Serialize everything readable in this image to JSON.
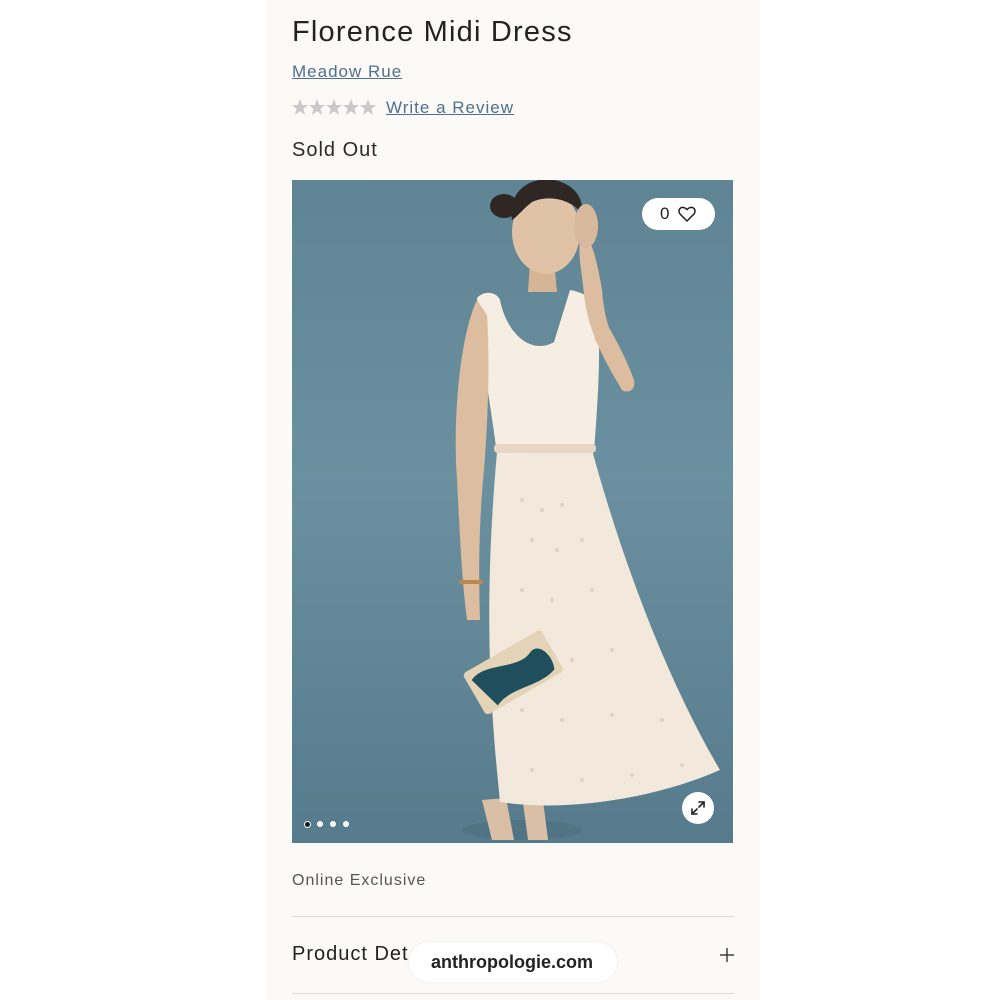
{
  "product": {
    "title": "Florence Midi Dress",
    "brand": "Meadow Rue",
    "rating": {
      "stars_filled": 0,
      "stars_total": 5,
      "review_link": "Write a Review"
    },
    "status": "Sold Out",
    "wishlist_count": "0",
    "tag": "Online Exclusive"
  },
  "gallery": {
    "image_count": 4,
    "active_index": 0,
    "icons": {
      "wishlist": "heart-outline-icon",
      "zoom": "expand-arrows-icon"
    }
  },
  "accordion": {
    "product_details_label": "Product Det",
    "toggle_icon": "plus-icon"
  },
  "watermark": "anthropologie.com",
  "colors": {
    "link": "#4f6f8e",
    "background": "#fbfaf6",
    "photo_backdrop": "#6b909f",
    "star_empty": "#c9c9c9"
  }
}
